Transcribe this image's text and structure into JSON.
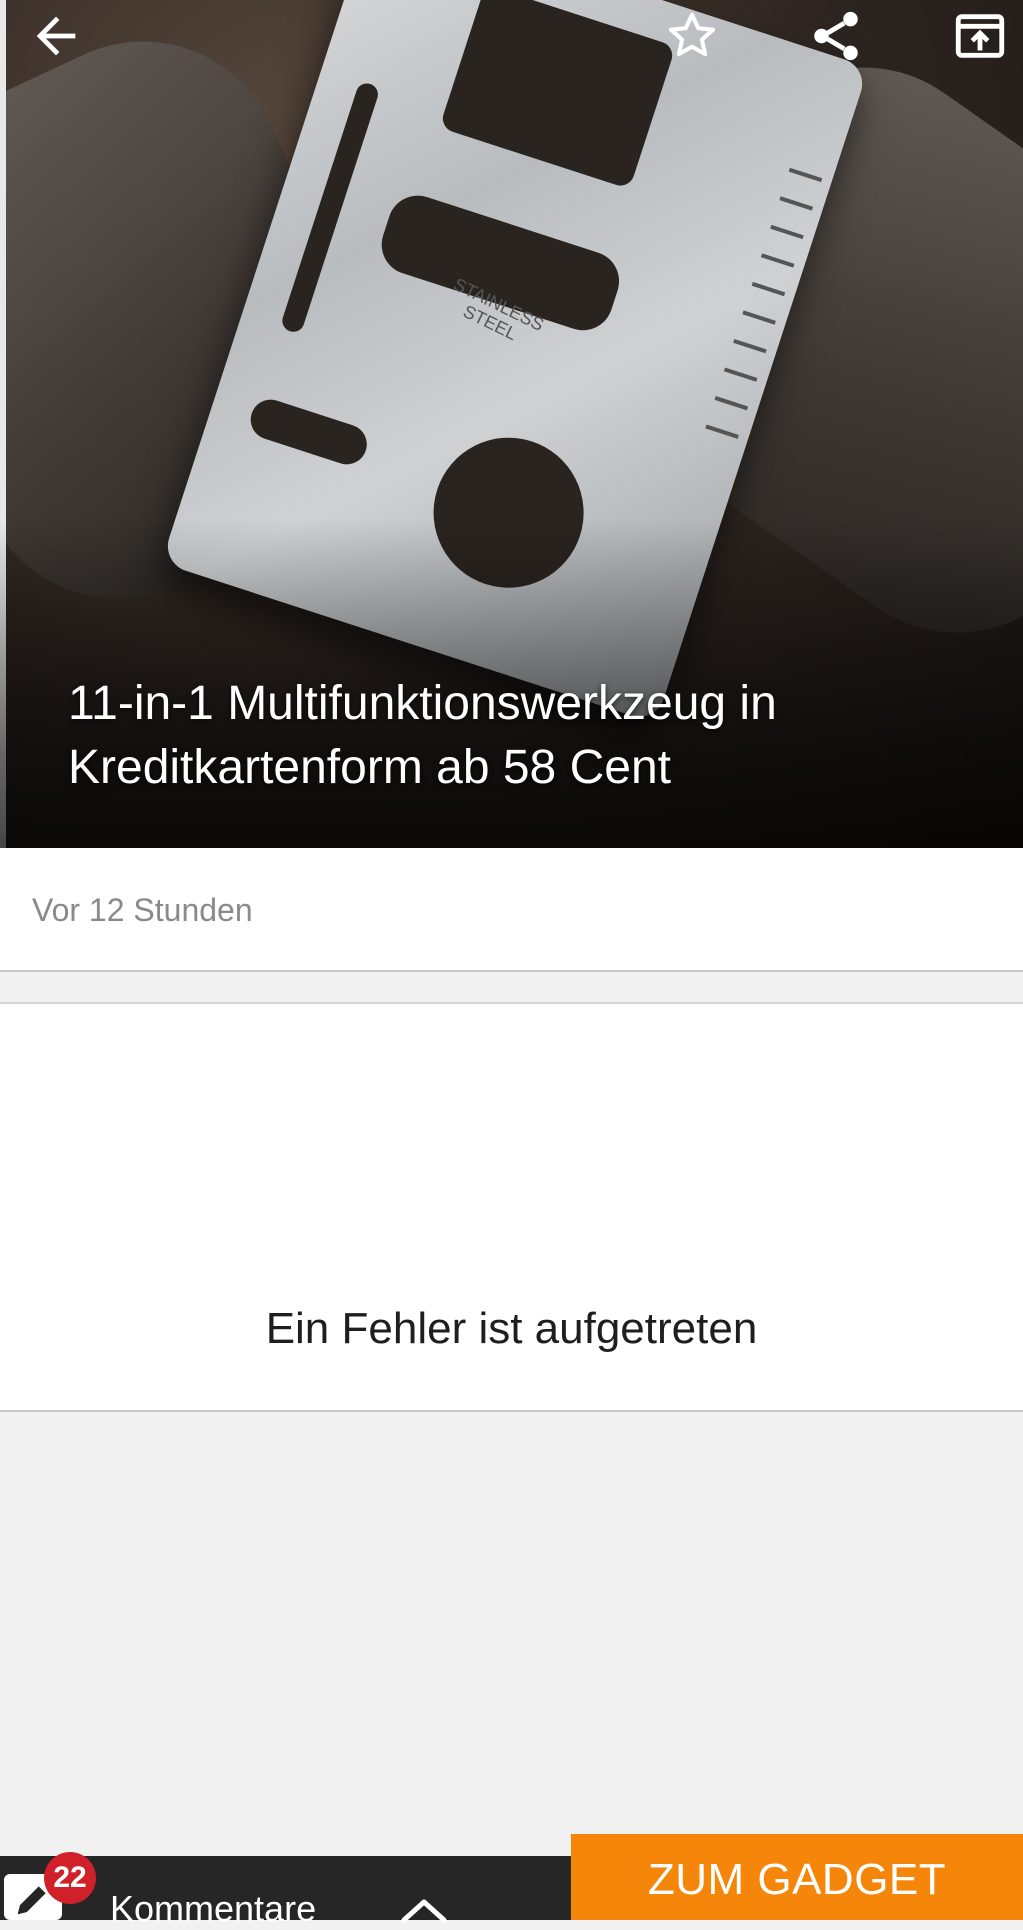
{
  "article": {
    "title": "11-in-1 Multifunktionswerkzeug in Kreditkartenform ab 58 Cent",
    "timestamp": "Vor 12 Stunden",
    "image_stamp_lines": [
      "STAINLESS",
      "STEEL"
    ]
  },
  "content": {
    "error_message": "Ein Fehler ist aufgetreten"
  },
  "toolbar": {
    "icons": [
      "back-arrow-icon",
      "star-outline-icon",
      "share-icon",
      "open-external-icon"
    ]
  },
  "bottom_bar": {
    "comment_count": "22",
    "comments_label": "Kommentare",
    "cta_label": "ZUM GADGET",
    "cta_color": "#f5860a",
    "badge_color": "#d0202a"
  }
}
